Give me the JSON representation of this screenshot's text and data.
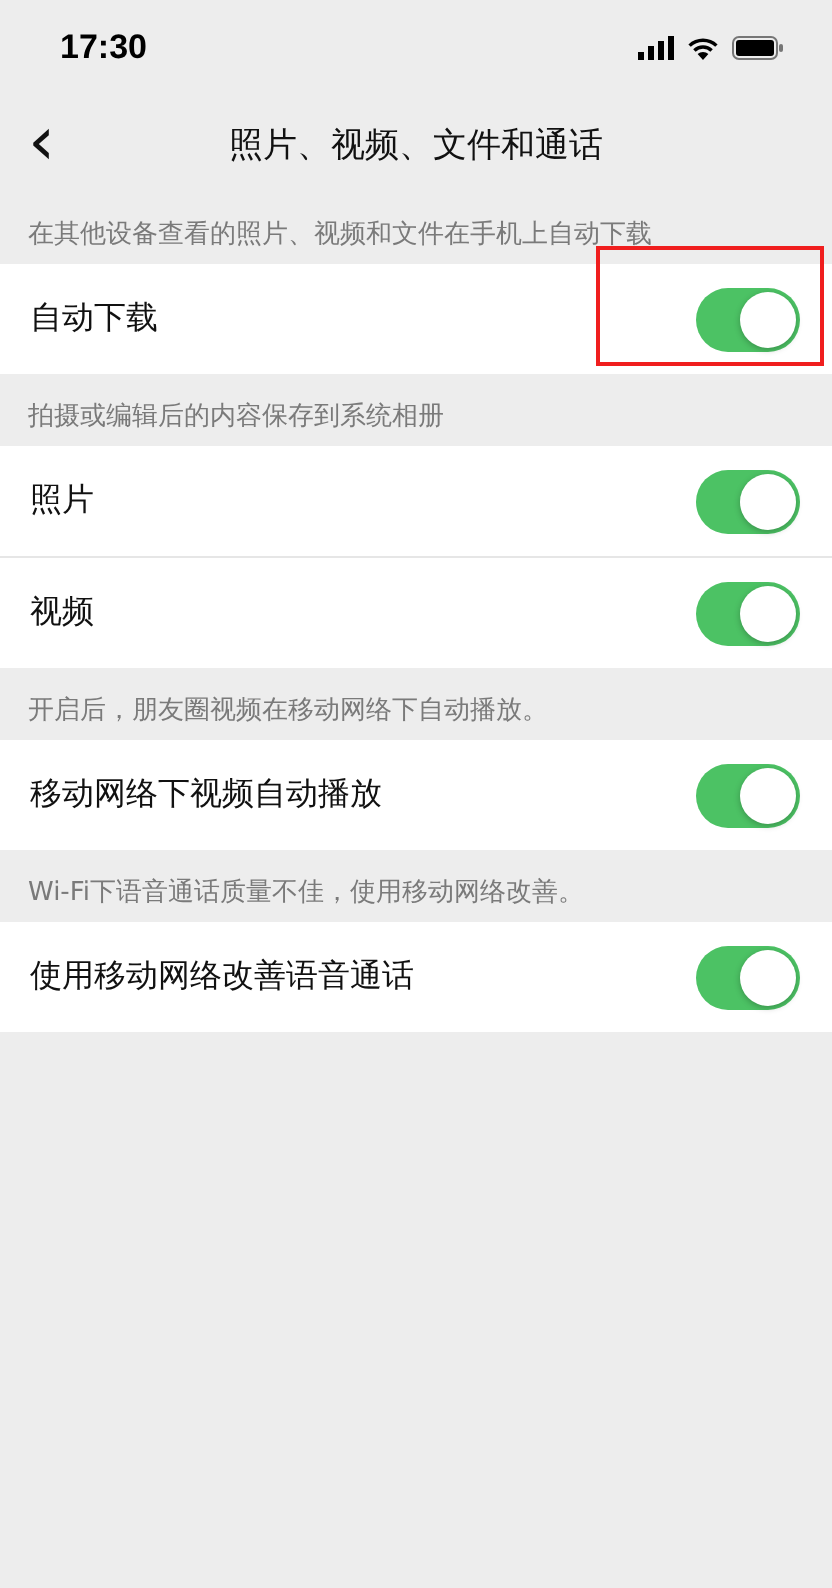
{
  "status_bar": {
    "time": "17:30"
  },
  "nav": {
    "back": "‹",
    "title": "照片、视频、文件和通话"
  },
  "sections": [
    {
      "header": "在其他设备查看的照片、视频和文件在手机上自动下载",
      "rows": [
        {
          "label": "自动下载",
          "on": true,
          "highlighted": true
        }
      ]
    },
    {
      "header": "拍摄或编辑后的内容保存到系统相册",
      "rows": [
        {
          "label": "照片",
          "on": true,
          "highlighted": false
        },
        {
          "label": "视频",
          "on": true,
          "highlighted": false
        }
      ]
    },
    {
      "header": "开启后，朋友圈视频在移动网络下自动播放。",
      "rows": [
        {
          "label": "移动网络下视频自动播放",
          "on": true,
          "highlighted": false
        }
      ]
    },
    {
      "header": "Wi-Fi下语音通话质量不佳，使用移动网络改善。",
      "rows": [
        {
          "label": "使用移动网络改善语音通话",
          "on": true,
          "highlighted": false
        }
      ]
    }
  ]
}
